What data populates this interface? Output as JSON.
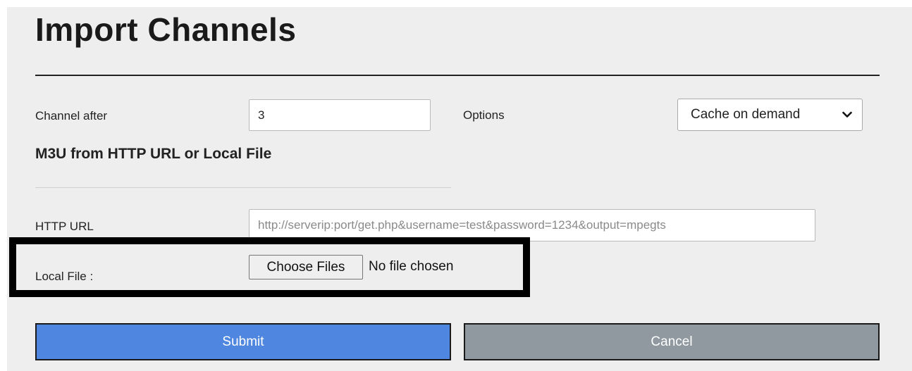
{
  "page": {
    "title": "Import Channels"
  },
  "form": {
    "channel_after_label": "Channel after",
    "channel_after_value": "3",
    "options_label": "Options",
    "options_selected": "Cache on demand",
    "section_title": "M3U from HTTP URL or Local File",
    "http_url_label": "HTTP URL",
    "http_url_placeholder": "http://serverip:port/get.php&username=test&password=1234&output=mpegts",
    "local_file_label": "Local File :",
    "choose_files_label": "Choose Files",
    "file_status": "No file chosen"
  },
  "actions": {
    "submit_label": "Submit",
    "cancel_label": "Cancel"
  },
  "colors": {
    "submit": "#4f86e0",
    "cancel": "#8f999f",
    "panel_bg": "#eeeeee"
  },
  "icons": {
    "options_dropdown": "chevron-down-icon"
  }
}
